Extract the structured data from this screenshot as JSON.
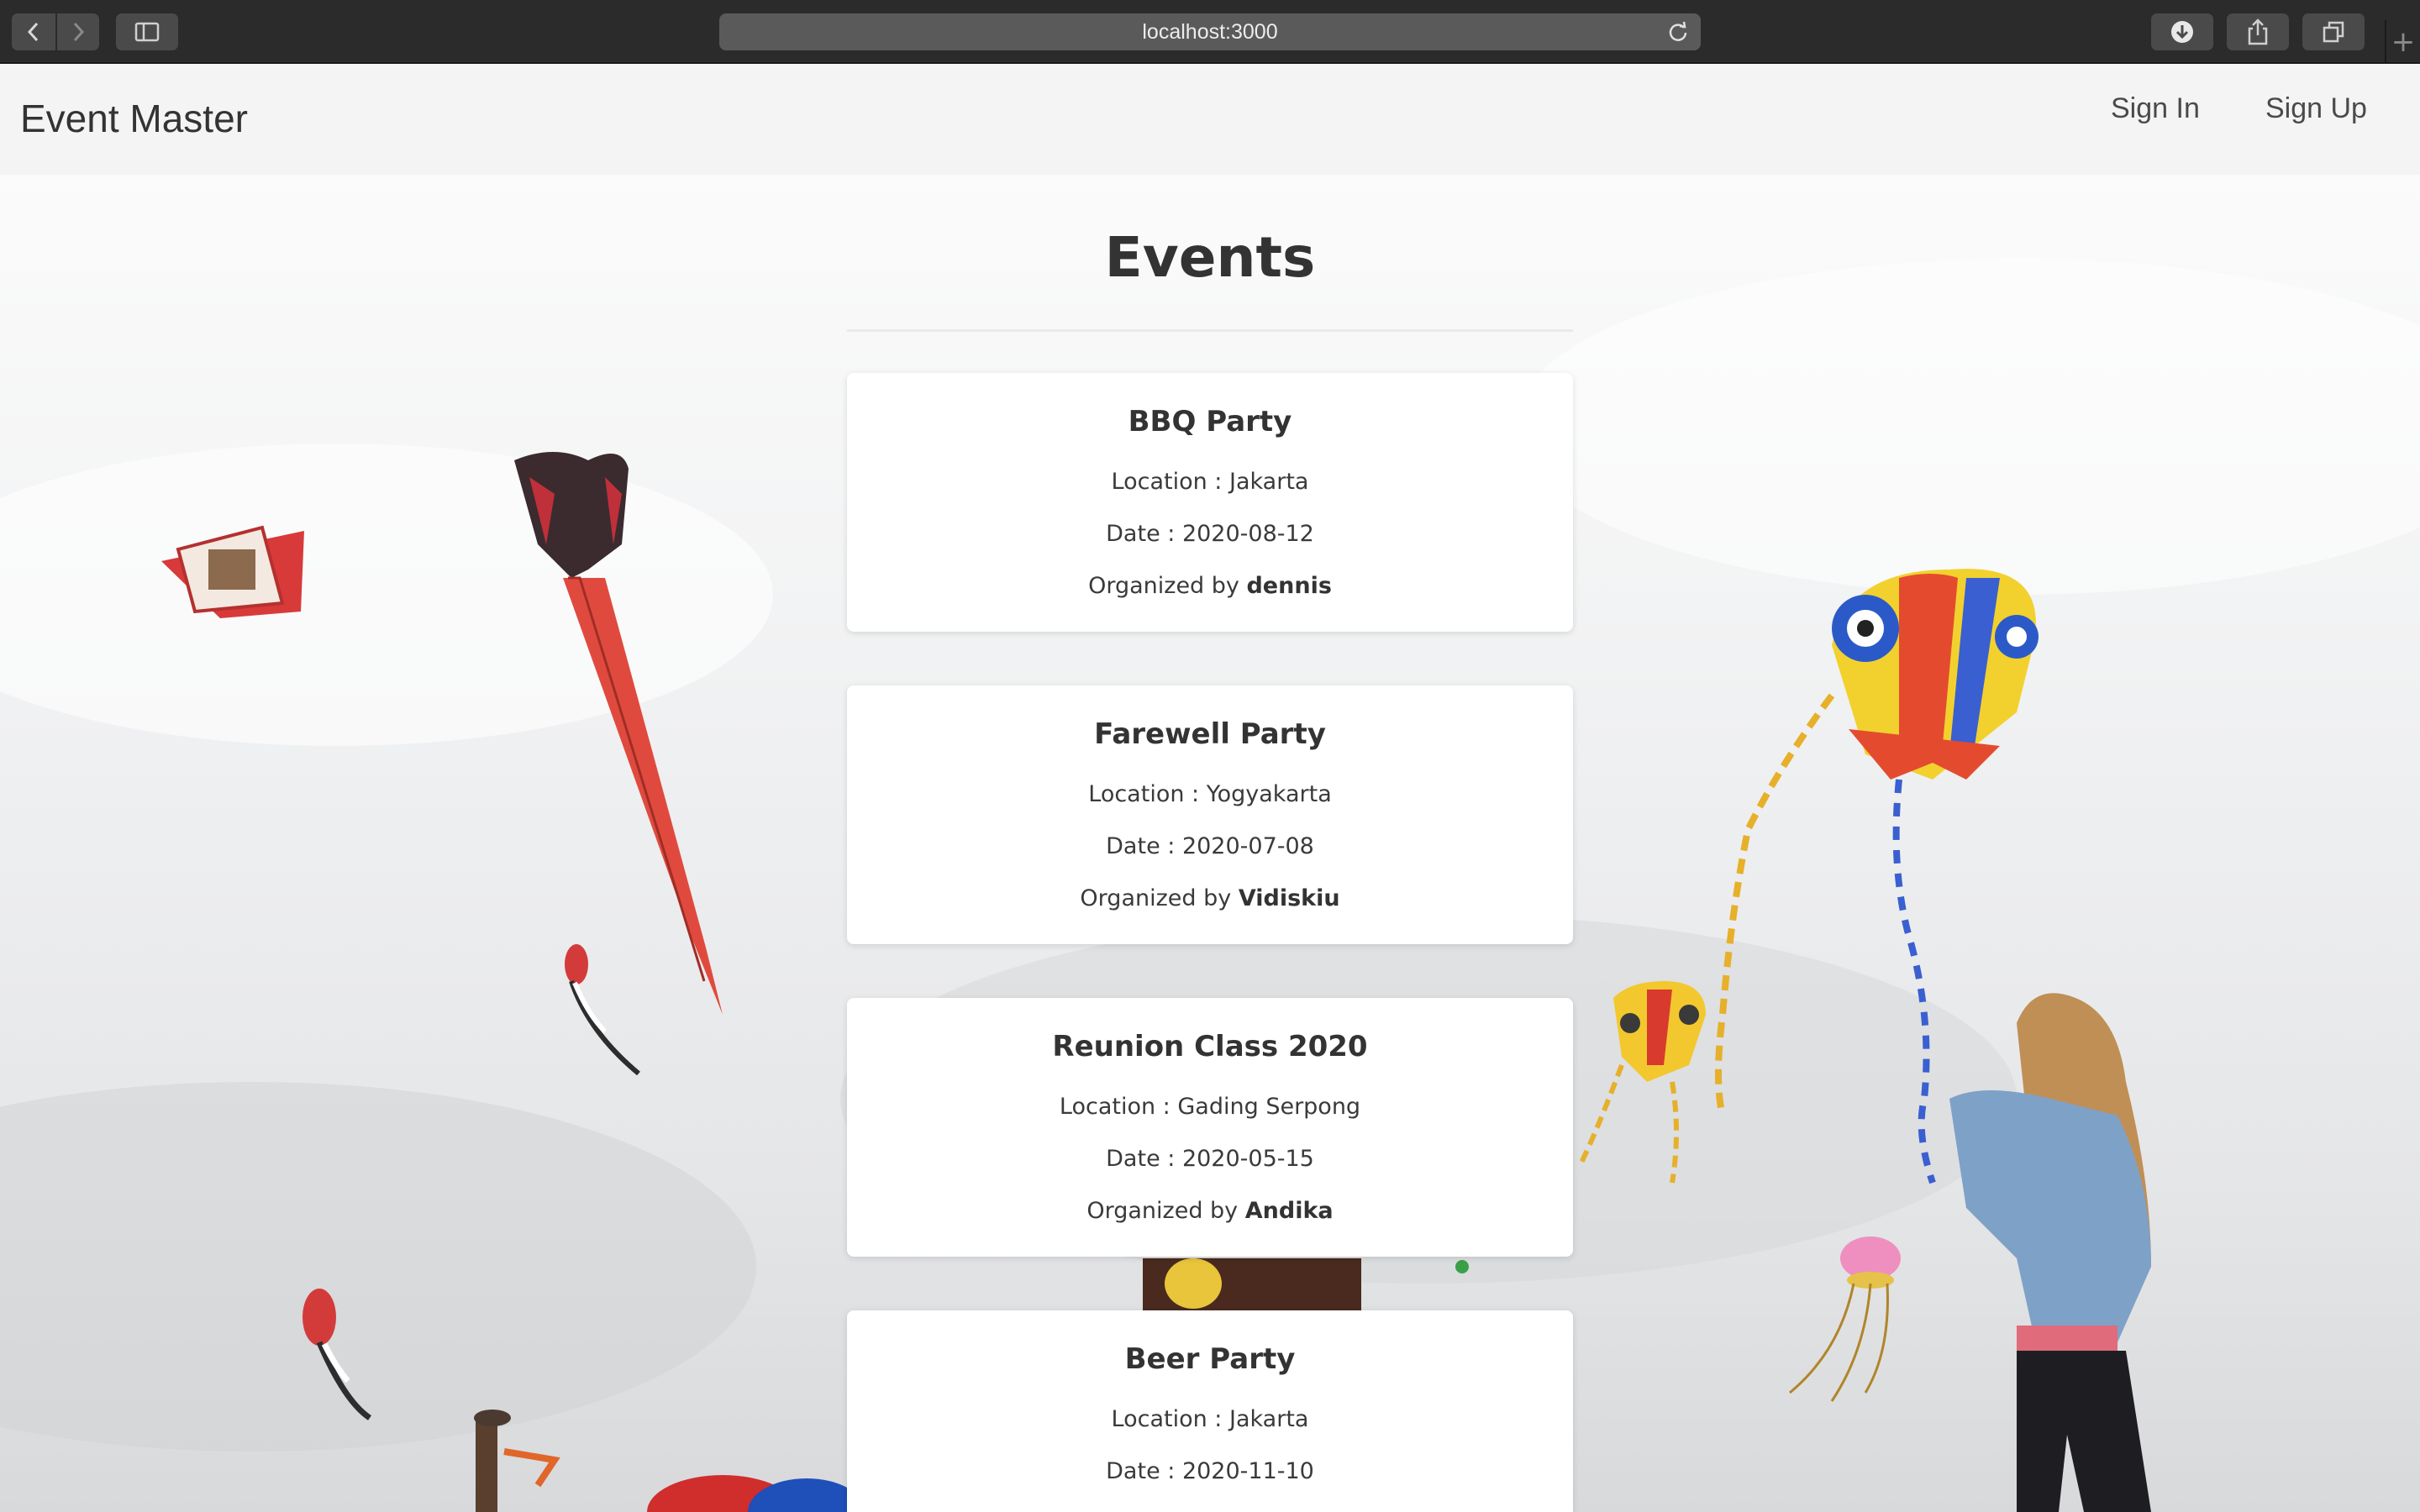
{
  "browser": {
    "url": "localhost:3000",
    "icons": [
      "back-icon",
      "forward-icon",
      "sidebar-icon",
      "reload-icon",
      "download-icon",
      "share-icon",
      "tabs-icon",
      "new-tab-icon"
    ]
  },
  "navbar": {
    "brand": "Event Master",
    "sign_in": "Sign In",
    "sign_up": "Sign Up"
  },
  "page": {
    "title": "Events"
  },
  "events": [
    {
      "name": "BBQ Party",
      "location_label": "Location : ",
      "location": "Jakarta",
      "date_label": "Date : ",
      "date": "2020-08-12",
      "organizer_label": "Organized by ",
      "organizer": "dennis"
    },
    {
      "name": "Farewell Party",
      "location_label": "Location : ",
      "location": "Yogyakarta",
      "date_label": "Date : ",
      "date": "2020-07-08",
      "organizer_label": "Organized by ",
      "organizer": "Vidiskiu"
    },
    {
      "name": "Reunion Class 2020",
      "location_label": "Location : ",
      "location": "Gading Serpong",
      "date_label": "Date : ",
      "date": "2020-05-15",
      "organizer_label": "Organized by ",
      "organizer": "Andika"
    },
    {
      "name": "Beer Party",
      "location_label": "Location : ",
      "location": "Jakarta",
      "date_label": "Date : ",
      "date": "2020-11-10"
    }
  ],
  "colors": {
    "chrome": "#2b2b2b",
    "navbar": "#f4f4f4",
    "text": "#333333",
    "card": "#ffffff"
  }
}
